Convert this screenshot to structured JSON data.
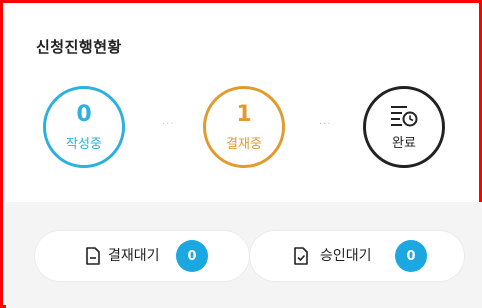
{
  "title": "신청진행현황",
  "steps": [
    {
      "count": "0",
      "label": "작성중"
    },
    {
      "count": "1",
      "label": "결재중"
    },
    {
      "icon": "list-clock-icon",
      "label": "완료"
    }
  ],
  "separator": "···",
  "pills": [
    {
      "icon": "document-icon",
      "label": "결재대기",
      "count": "0"
    },
    {
      "icon": "document-check-icon",
      "label": "승인대기",
      "count": "0"
    }
  ],
  "colors": {
    "blue": "#2bb0e0",
    "orange": "#e39a2d",
    "dark": "#222222",
    "badge": "#1ba7e0",
    "border": "#ff0000"
  }
}
